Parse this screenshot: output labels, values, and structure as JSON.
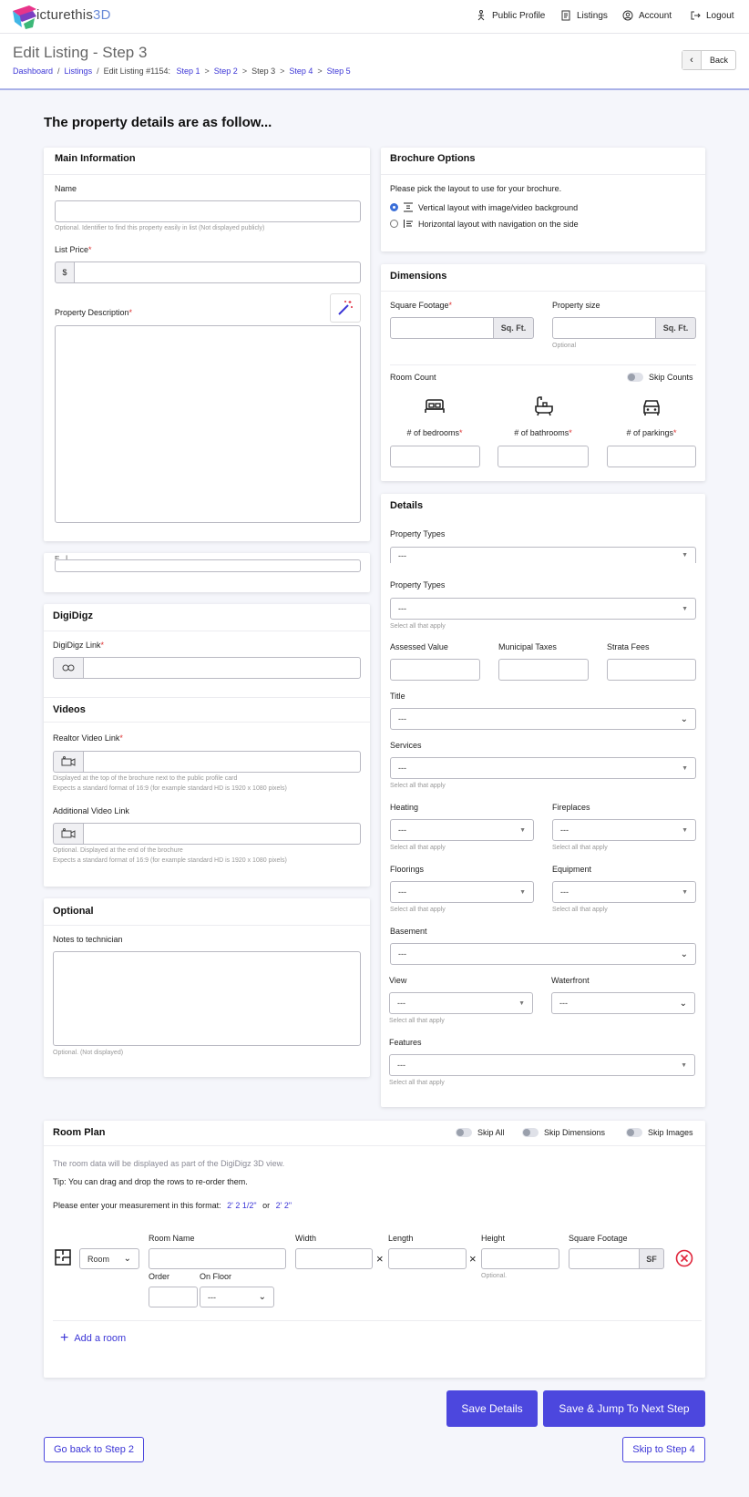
{
  "app": {
    "logo_main": "icturethis",
    "logo_accent": "3D"
  },
  "topnav": {
    "public_profile": "Public Profile",
    "listings": "Listings",
    "account": "Account",
    "logout": "Logout"
  },
  "header": {
    "title": "Edit Listing - Step 3",
    "breadcrumb": {
      "dashboard": "Dashboard",
      "listings": "Listings",
      "current": "Edit Listing #1154:",
      "step1": "Step 1",
      "step2": "Step 2",
      "step3": "Step 3",
      "step4": "Step 4",
      "step5": "Step 5",
      "arrow": ">",
      "slash": "/"
    },
    "back": "Back"
  },
  "page_heading": "The property details are as follow...",
  "main_info": {
    "title": "Main Information",
    "name_label": "Name",
    "name_hint": "Optional. Identifier to find this property easily in list (Not displayed publicly)",
    "price_label": "List Price",
    "currency": "$",
    "description_label": "Property Description",
    "req": "*"
  },
  "cut_card_text": "E...İ",
  "digidigz": {
    "title": "DigiDigz",
    "link_label": "DigiDigz Link"
  },
  "videos": {
    "title": "Videos",
    "realtor_label": "Realtor Video Link",
    "realtor_hint1": "Displayed at the top of the brochure next to the public profile card",
    "realtor_hint2": "Expects a standard format of 16:9 (for example standard HD is 1920 x 1080 pixels)",
    "additional_label": "Additional Video Link",
    "additional_hint1": "Optional. Displayed at the end of the brochure",
    "additional_hint2": "Expects a standard format of 16:9 (for example standard HD is 1920 x 1080 pixels)"
  },
  "optional": {
    "title": "Optional",
    "notes_label": "Notes to technician",
    "notes_hint": "Optional. (Not displayed)"
  },
  "brochure": {
    "title": "Brochure Options",
    "intro": "Please pick the layout to use for your brochure.",
    "option_vertical": "Vertical layout with image/video background",
    "option_horizontal": "Horizontal layout with navigation on the side",
    "selected": "vertical"
  },
  "dimensions": {
    "title": "Dimensions",
    "sqft_label": "Square Footage",
    "sqft_unit": "Sq. Ft.",
    "size_label": "Property size",
    "size_unit": "Sq. Ft.",
    "size_hint": "Optional",
    "room_count": "Room Count",
    "skip_counts": "Skip Counts",
    "bedrooms": "# of bedrooms",
    "bathrooms": "# of bathrooms",
    "parkings": "# of parkings"
  },
  "details": {
    "title": "Details",
    "property_types": "Property Types",
    "placeholder": "---",
    "select_all": "Select all that apply",
    "assessed": "Assessed Value",
    "municipal": "Municipal Taxes",
    "strata": "Strata Fees",
    "title_label": "Title",
    "services": "Services",
    "heating": "Heating",
    "fireplaces": "Fireplaces",
    "floorings": "Floorings",
    "equipment": "Equipment",
    "basement": "Basement",
    "view": "View",
    "waterfront": "Waterfront",
    "features": "Features"
  },
  "room_plan": {
    "title": "Room Plan",
    "skip_all": "Skip All",
    "skip_dimensions": "Skip Dimensions",
    "skip_images": "Skip Images",
    "info": "The room data will be displayed as part of the DigiDigz 3D view.",
    "tip": "Tip: You can drag and drop the rows to re-order them.",
    "format_text": "Please enter your measurement in this format:",
    "format_ex1": "2' 2 1/2\"",
    "format_or": "or",
    "format_ex2": "2' 2\"",
    "room_type": "Room",
    "room_name": "Room Name",
    "width": "Width",
    "length": "Length",
    "height": "Height",
    "height_hint": "Optional.",
    "square_footage": "Square Footage",
    "sf": "SF",
    "times": "×",
    "order": "Order",
    "on_floor": "On Floor",
    "floor_value": "---",
    "add_room": "Add a room"
  },
  "actions": {
    "save": "Save Details",
    "save_next": "Save & Jump To Next Step",
    "go_back": "Go back to Step 2",
    "skip": "Skip to Step 4"
  },
  "colors": {
    "accent": "#4c47de",
    "link": "#3b35d6",
    "danger": "#e0253b",
    "required": "#dd3333"
  }
}
